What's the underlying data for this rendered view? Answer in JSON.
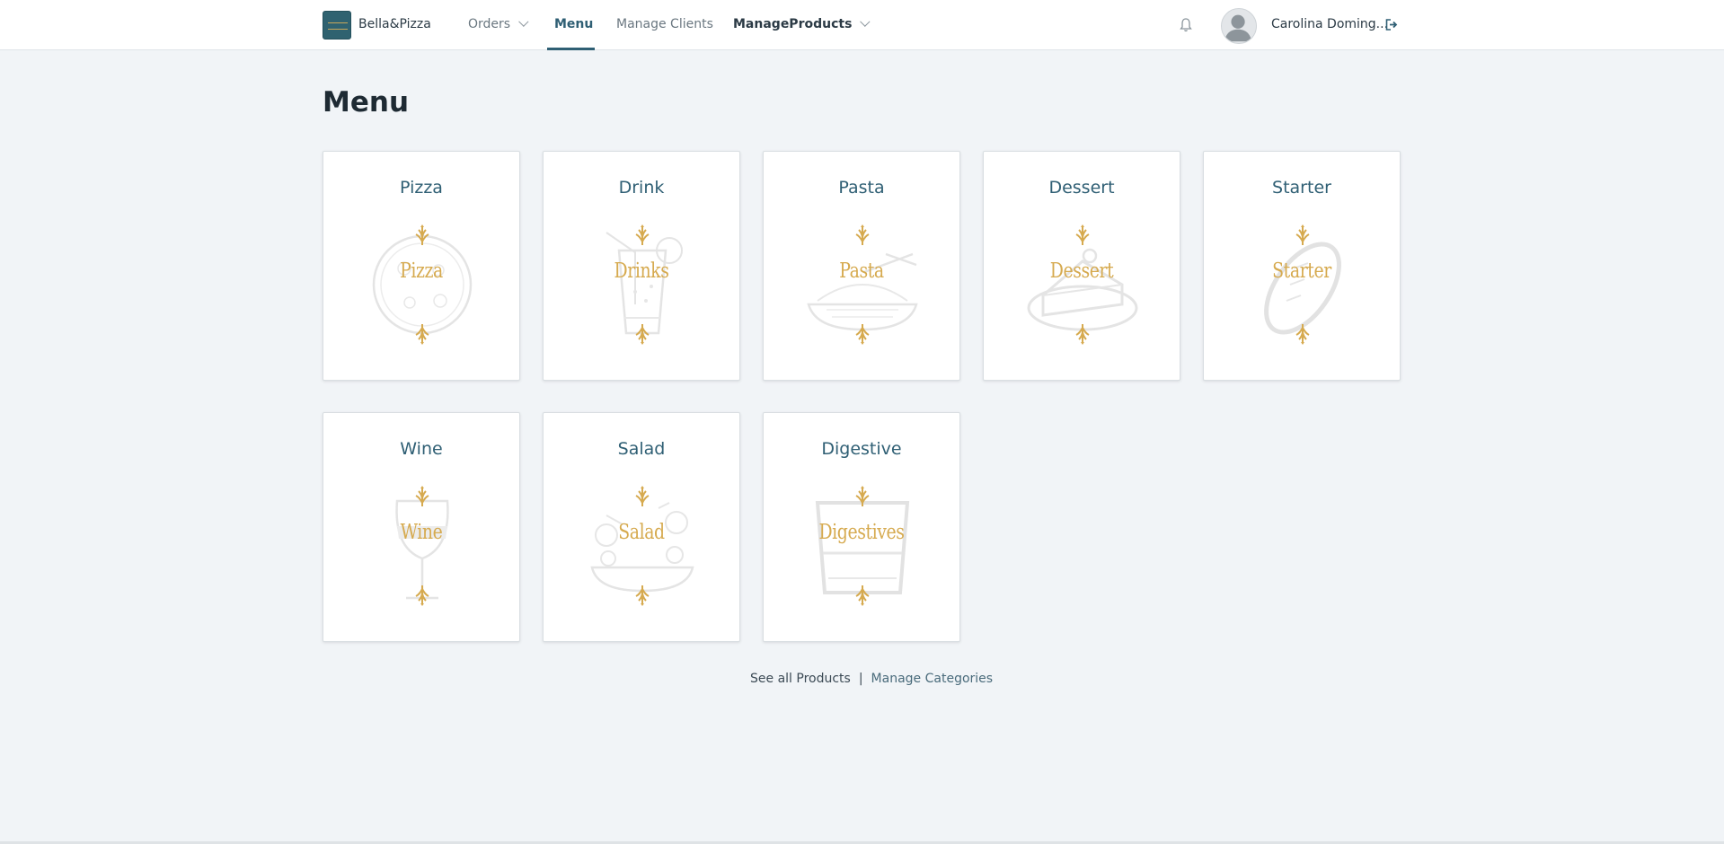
{
  "header": {
    "brand": "Bella&Pizza",
    "nav": {
      "orders": "Orders",
      "menu": "Menu",
      "manage_clients": "Manage Clients",
      "manage_products": "ManageProducts"
    },
    "user_name": "Carolina Doming..."
  },
  "main": {
    "title": "Menu",
    "categories": [
      {
        "label": "Pizza",
        "art_word": "Pizza",
        "icon": "pizza-icon"
      },
      {
        "label": "Drink",
        "art_word": "Drinks",
        "icon": "drink-icon"
      },
      {
        "label": "Pasta",
        "art_word": "Pasta",
        "icon": "pasta-icon"
      },
      {
        "label": "Dessert",
        "art_word": "Dessert",
        "icon": "cake-icon"
      },
      {
        "label": "Starter",
        "art_word": "Starter",
        "icon": "bread-icon"
      },
      {
        "label": "Wine",
        "art_word": "Wine",
        "icon": "wine-glass-icon"
      },
      {
        "label": "Salad",
        "art_word": "Salad",
        "icon": "salad-icon"
      },
      {
        "label": "Digestive",
        "art_word": "Digestives",
        "icon": "tumbler-glass-icon"
      }
    ]
  },
  "footer": {
    "see_all": "See all Products",
    "separator": "|",
    "manage_categories": "Manage Categories"
  },
  "colors": {
    "accent": "#2f5f74",
    "gold": "#d6aa4f",
    "background": "#f1f4f7"
  }
}
